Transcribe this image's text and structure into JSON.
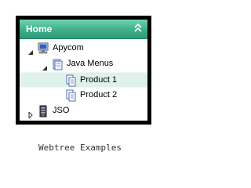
{
  "menu": {
    "header_title": "Home",
    "items": [
      {
        "label": "Apycom",
        "expanded": true,
        "icon": "computer-icon"
      },
      {
        "label": "Java Menus",
        "expanded": true,
        "icon": "folder-icon"
      },
      {
        "label": "Product 1",
        "selected": true,
        "icon": "document-icon"
      },
      {
        "label": "Product 2",
        "icon": "document-icon"
      },
      {
        "label": "JSO",
        "expanded": false,
        "icon": "server-icon"
      }
    ]
  },
  "caption": "Webtree Examples",
  "colors": {
    "frame": "#000000",
    "header": "#3fae8a",
    "selected_row": "#def1ea"
  }
}
